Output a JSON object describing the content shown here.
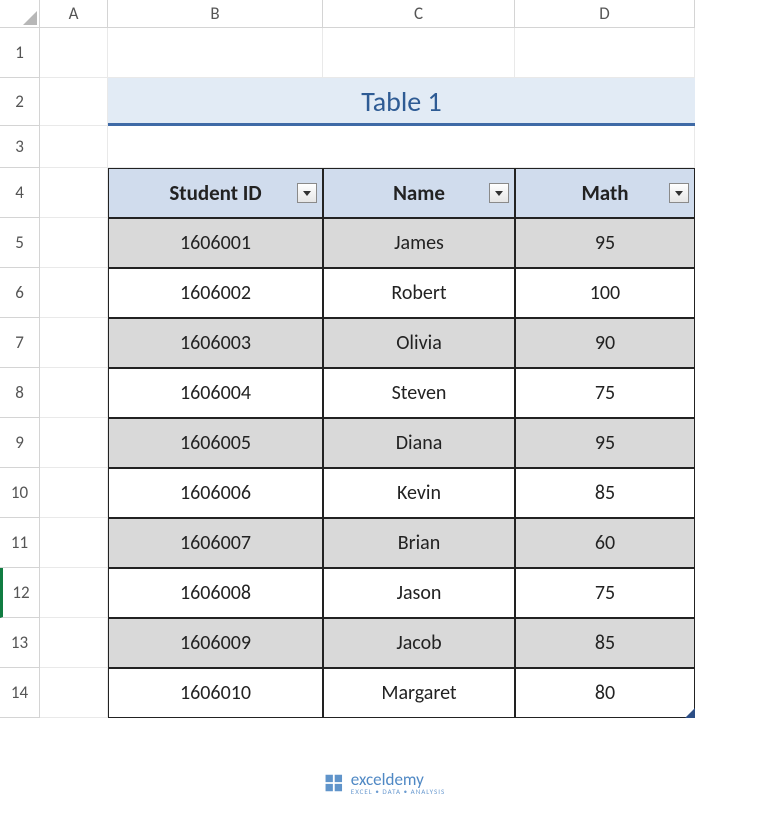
{
  "columns": [
    "",
    "A",
    "B",
    "C",
    "D"
  ],
  "row_headers": [
    "1",
    "2",
    "3",
    "4",
    "5",
    "6",
    "7",
    "8",
    "9",
    "10",
    "11",
    "12",
    "13",
    "14"
  ],
  "selected_row": 12,
  "title": "Table 1",
  "headers": [
    "Student ID",
    "Name",
    "Math"
  ],
  "rows": [
    {
      "id": "1606001",
      "name": "James",
      "math": "95"
    },
    {
      "id": "1606002",
      "name": "Robert",
      "math": "100"
    },
    {
      "id": "1606003",
      "name": "Olivia",
      "math": "90"
    },
    {
      "id": "1606004",
      "name": "Steven",
      "math": "75"
    },
    {
      "id": "1606005",
      "name": "Diana",
      "math": "95"
    },
    {
      "id": "1606006",
      "name": "Kevin",
      "math": "85"
    },
    {
      "id": "1606007",
      "name": "Brian",
      "math": "60"
    },
    {
      "id": "1606008",
      "name": "Jason",
      "math": "75"
    },
    {
      "id": "1606009",
      "name": "Jacob",
      "math": "85"
    },
    {
      "id": "1606010",
      "name": "Margaret",
      "math": "80"
    }
  ],
  "watermark": {
    "text": "exceldemy",
    "sub": "EXCEL • DATA • ANALYSIS"
  },
  "chart_data": {
    "type": "table",
    "title": "Table 1",
    "columns": [
      "Student ID",
      "Name",
      "Math"
    ],
    "data": [
      [
        1606001,
        "James",
        95
      ],
      [
        1606002,
        "Robert",
        100
      ],
      [
        1606003,
        "Olivia",
        90
      ],
      [
        1606004,
        "Steven",
        75
      ],
      [
        1606005,
        "Diana",
        95
      ],
      [
        1606006,
        "Kevin",
        85
      ],
      [
        1606007,
        "Brian",
        60
      ],
      [
        1606008,
        "Jason",
        75
      ],
      [
        1606009,
        "Jacob",
        85
      ],
      [
        1606010,
        "Margaret",
        80
      ]
    ]
  }
}
